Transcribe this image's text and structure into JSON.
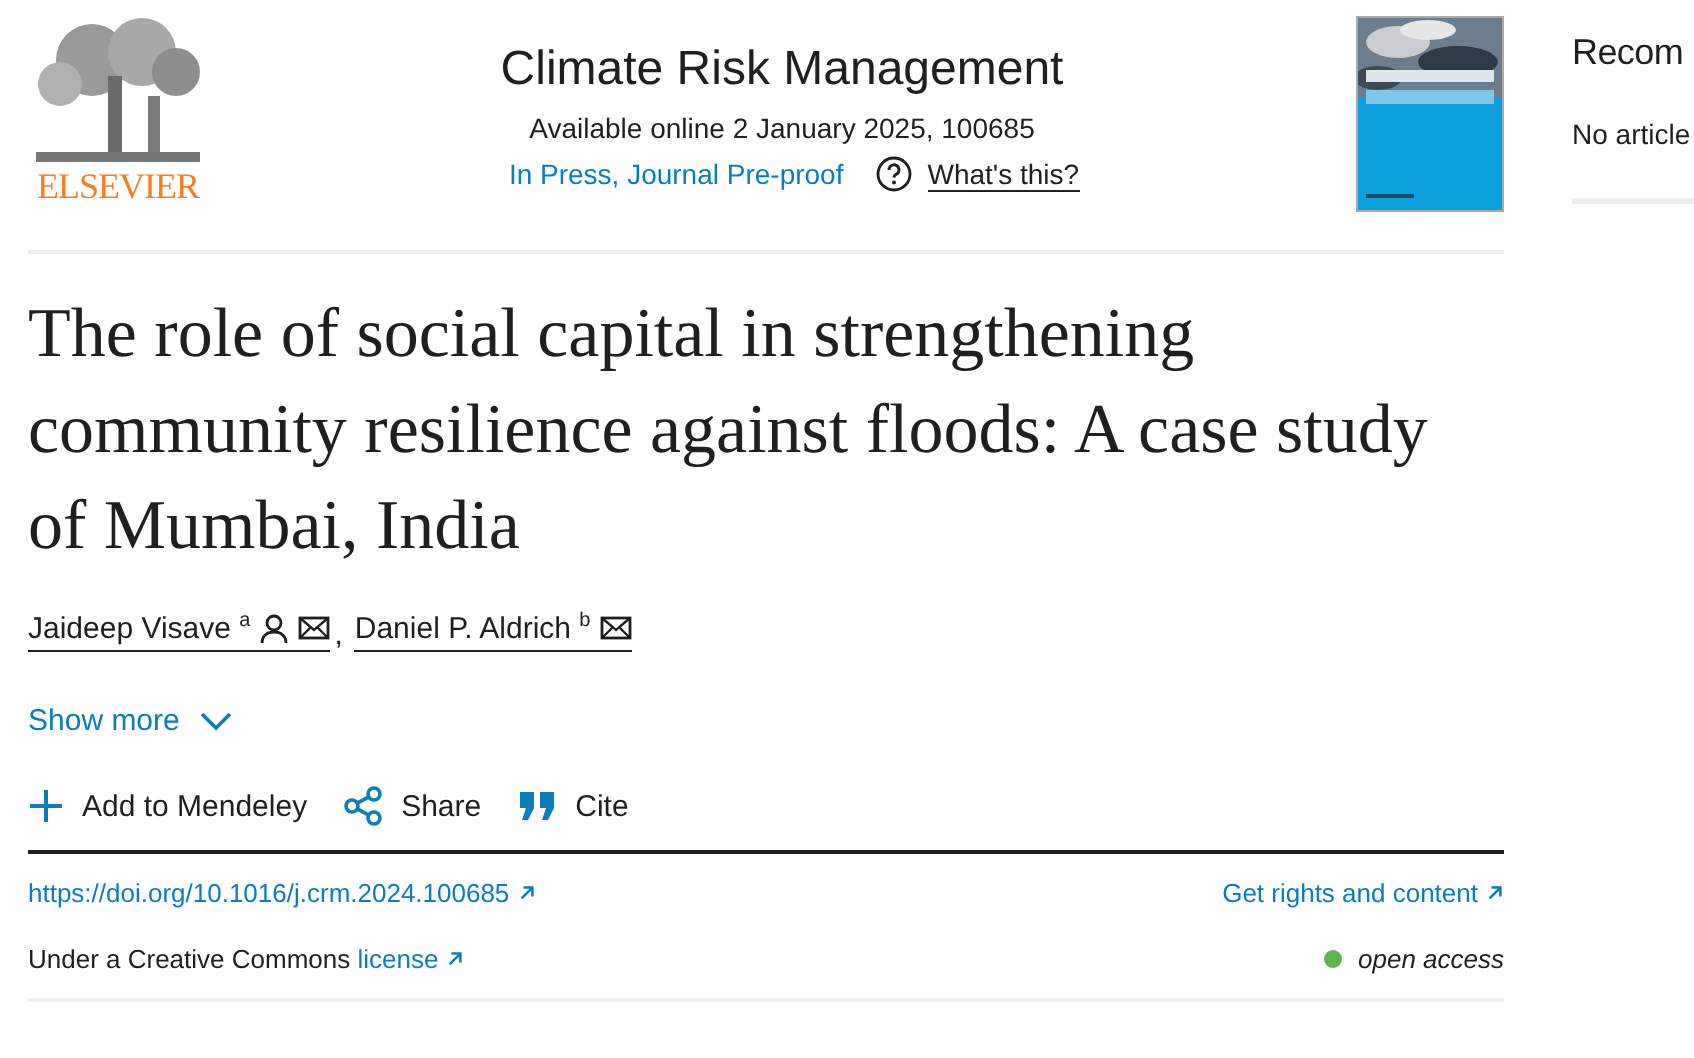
{
  "publisher_logo": {
    "text": "ELSEVIER"
  },
  "journal": {
    "title": "Climate Risk Management",
    "availability": "Available online 2 January 2025, 100685",
    "status": "In Press, Journal Pre-proof",
    "help_link": "What's this?"
  },
  "article": {
    "title": "The role of social capital in strengthening community resilience against floods: A case study of Mumbai, India",
    "authors": [
      {
        "name": "Jaideep Visave",
        "affiliation": "a",
        "corresponding": true,
        "email": true
      },
      {
        "name": "Daniel P. Aldrich",
        "affiliation": "b",
        "corresponding": false,
        "email": true
      }
    ],
    "author_separator": ",",
    "show_more": "Show more",
    "actions": [
      {
        "kind": "add",
        "label": "Add to Mendeley"
      },
      {
        "kind": "share",
        "label": "Share"
      },
      {
        "kind": "cite",
        "label": "Cite"
      }
    ],
    "doi": "https://doi.org/10.1016/j.crm.2024.100685",
    "rights": "Get rights and content",
    "license_text": "Under a Creative Commons",
    "license_link": "license",
    "access": {
      "label": "open access",
      "color": "#5ab54b"
    }
  },
  "sidebar": {
    "heading": "Recom",
    "message": "No article"
  }
}
